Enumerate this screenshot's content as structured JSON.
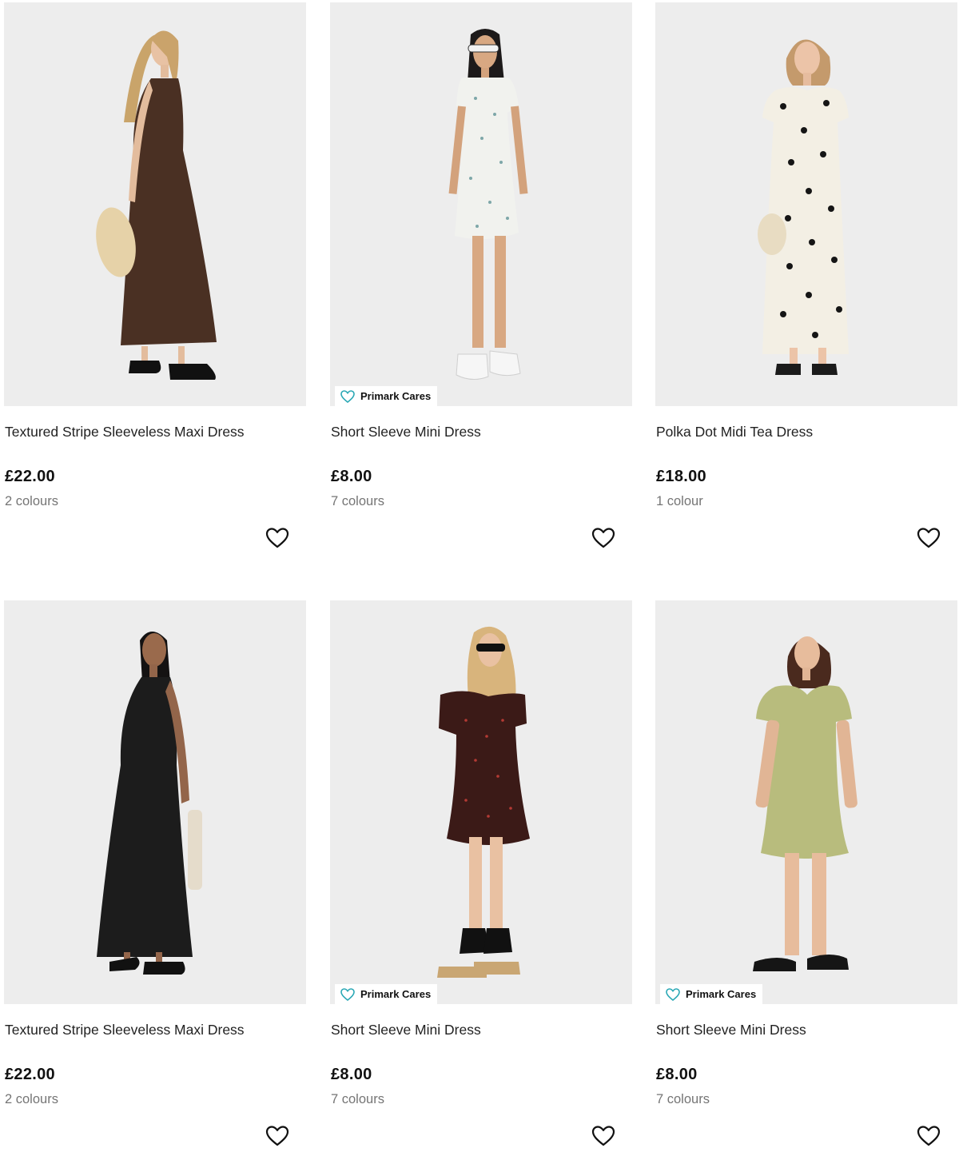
{
  "products": [
    {
      "title": "Textured Stripe Sleeveless Maxi Dress",
      "price": "£22.00",
      "colours": "2 colours",
      "badge": "",
      "dress_color": "#4a3023",
      "icon": "heart-outline-icon"
    },
    {
      "title": "Short Sleeve Mini Dress",
      "price": "£8.00",
      "colours": "7 colours",
      "badge": "Primark Cares",
      "dress_color": "#f1f2ee",
      "icon": "heart-outline-icon"
    },
    {
      "title": "Polka Dot Midi Tea Dress",
      "price": "£18.00",
      "colours": "1 colour",
      "badge": "",
      "dress_color": "#f3efe4",
      "icon": "heart-outline-icon"
    },
    {
      "title": "Textured Stripe Sleeveless Maxi Dress",
      "price": "£22.00",
      "colours": "2 colours",
      "badge": "",
      "dress_color": "#1c1c1c",
      "icon": "heart-outline-icon"
    },
    {
      "title": "Short Sleeve Mini Dress",
      "price": "£8.00",
      "colours": "7 colours",
      "badge": "Primark Cares",
      "dress_color": "#3b1a17",
      "icon": "heart-outline-icon"
    },
    {
      "title": "Short Sleeve Mini Dress",
      "price": "£8.00",
      "colours": "7 colours",
      "badge": "Primark Cares",
      "dress_color": "#b8bc7d",
      "icon": "heart-outline-icon"
    }
  ],
  "colors": {
    "badge_accent": "#2aa8b5",
    "photo_background": "#ededed"
  }
}
